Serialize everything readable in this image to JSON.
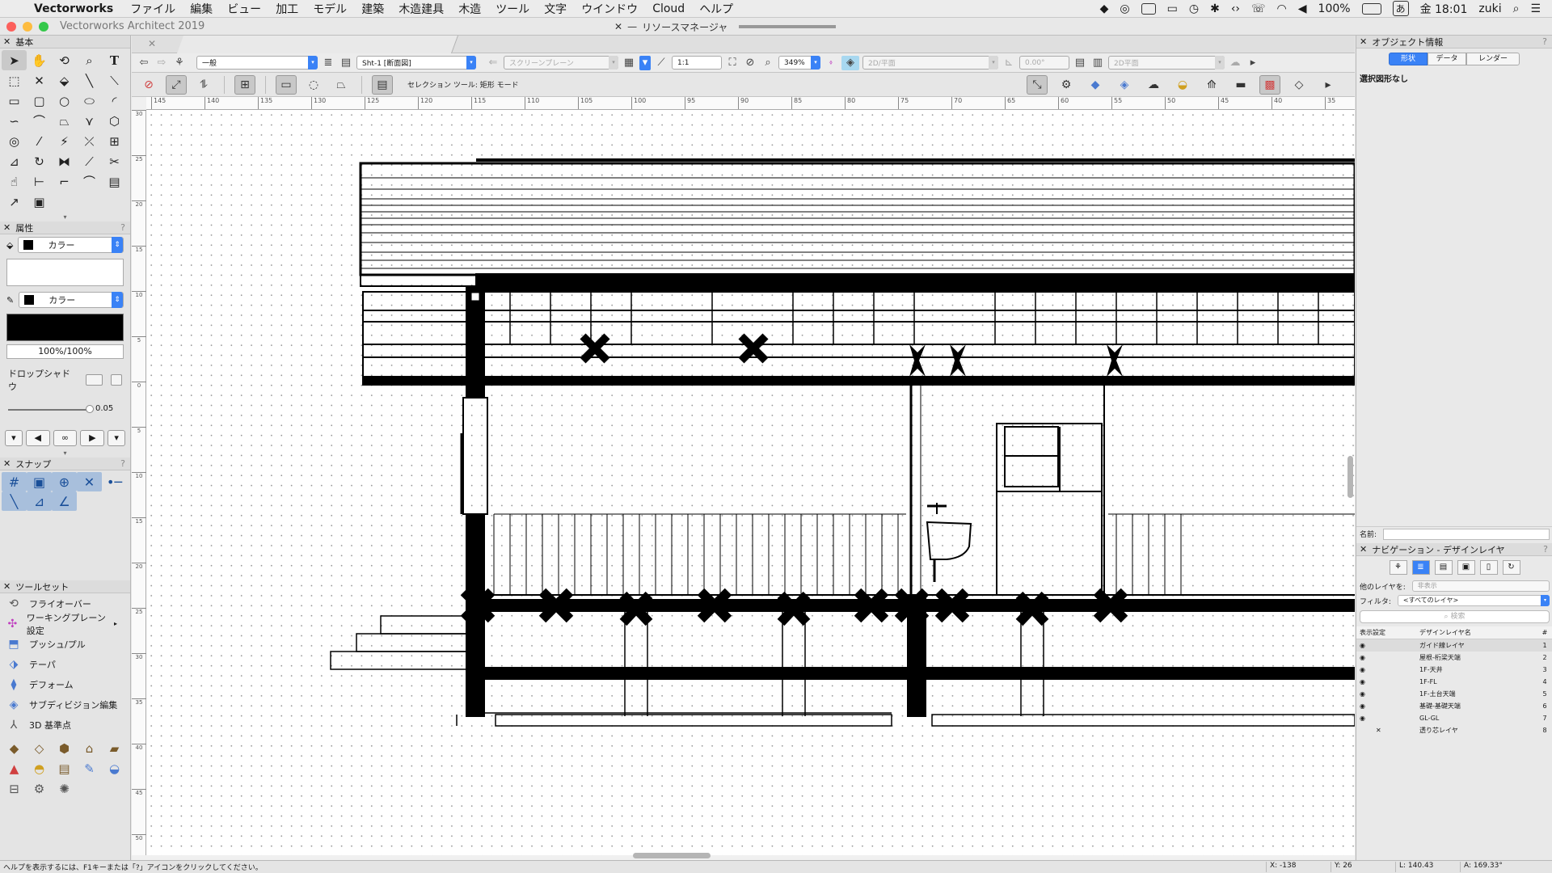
{
  "menubar": {
    "app": "Vectorworks",
    "menus": [
      "ファイル",
      "編集",
      "ビュー",
      "加工",
      "モデル",
      "建築",
      "木造建具",
      "木造",
      "ツール",
      "文字",
      "ウインドウ",
      "Cloud",
      "ヘルプ"
    ],
    "battery": "100%",
    "clock": "金 18:01",
    "user": "zuki"
  },
  "window": {
    "title": "Vectorworks Architect 2019",
    "resource_manager": "リソースマネージャ",
    "traffic_lights": [
      "#fc605c",
      "#fdbc40",
      "#34c84a"
    ]
  },
  "basic_palette": {
    "title": "基本",
    "tools": [
      "selection-arrow",
      "pan-hand",
      "flyover",
      "zoom",
      "text",
      "rectangle-marquee",
      "cut",
      "paint-bucket",
      "line",
      "double-line",
      "rectangle",
      "rounded-rectangle",
      "circle",
      "oval",
      "arc",
      "freehand",
      "polyline",
      "polygon-fill",
      "double-polyline",
      "regular-polygon",
      "spiral",
      "eyedropper",
      "magic-wand",
      "selection-plus",
      "reshape",
      "dimension",
      "rotate",
      "mirror",
      "offset",
      "trim",
      "fillet",
      "connect",
      "split",
      "chamfer",
      "viewport"
    ]
  },
  "attributes": {
    "title": "属性",
    "fill_label": "カラー",
    "pen_label": "カラー",
    "opacity": "100%/100%",
    "drop_shadow": "ドロップシャドウ",
    "line_weight": "0.05"
  },
  "snap_palette": {
    "title": "スナップ"
  },
  "toolsets": {
    "title": "ツールセット",
    "items": [
      "フライオーバー",
      "ワーキングプレーン設定",
      "プッシュ/プル",
      "テーパ",
      "デフォーム",
      "サブディビジョン編集",
      "3D 基準点"
    ]
  },
  "viewbar": {
    "class": "一般",
    "layer": "Sht-1 [断面図]",
    "plane": "スクリーンプレーン",
    "scale": "1:1",
    "zoom": "349%",
    "view": "2D/平面",
    "angle": "0.00°",
    "render": "2D平面"
  },
  "modebar": {
    "label": "セレクション ツール: 矩形 モード"
  },
  "ruler": {
    "ticks": [
      "145",
      "140",
      "135",
      "130",
      "125",
      "120",
      "115",
      "110",
      "105",
      "100",
      "95",
      "90",
      "85",
      "80",
      "75",
      "70",
      "65",
      "60",
      "55",
      "50",
      "45",
      "40",
      "35"
    ],
    "vticks": [
      "30",
      "25",
      "20",
      "15",
      "10",
      "5",
      "0",
      "5",
      "10",
      "15",
      "20",
      "25",
      "30",
      "35",
      "40",
      "45",
      "50"
    ]
  },
  "object_info": {
    "title": "オブジェクト情報",
    "tabs": [
      "形状",
      "データ",
      "レンダー"
    ],
    "nothing_selected": "選択図形なし",
    "name_label": "名前:"
  },
  "navigation": {
    "title": "ナビゲーション - デザインレイヤ",
    "other_layers_label": "他のレイヤを:",
    "other_layers_value": "非表示",
    "filter_label": "フィルタ:",
    "filter_value": "<すべてのレイヤ>",
    "search_placeholder": "検索",
    "headers": [
      "表示設定",
      "デザインレイヤ名",
      "#"
    ],
    "layers": [
      {
        "name": "ガイド線レイヤ",
        "num": "1"
      },
      {
        "name": "屋根-桁梁天端",
        "num": "2"
      },
      {
        "name": "1F-天井",
        "num": "3"
      },
      {
        "name": "1F-FL",
        "num": "4"
      },
      {
        "name": "1F-土台天端",
        "num": "5"
      },
      {
        "name": "基礎-基礎天端",
        "num": "6"
      },
      {
        "name": "GL-GL",
        "num": "7"
      },
      {
        "name": "透り芯レイヤ",
        "num": "8"
      }
    ]
  },
  "status": {
    "help": "ヘルプを表示するには、F1キーまたは「?」アイコンをクリックしてください。",
    "x": "X: -138",
    "y": "Y: 26",
    "l": "L: 140.43",
    "a": "A: 169.33°"
  }
}
